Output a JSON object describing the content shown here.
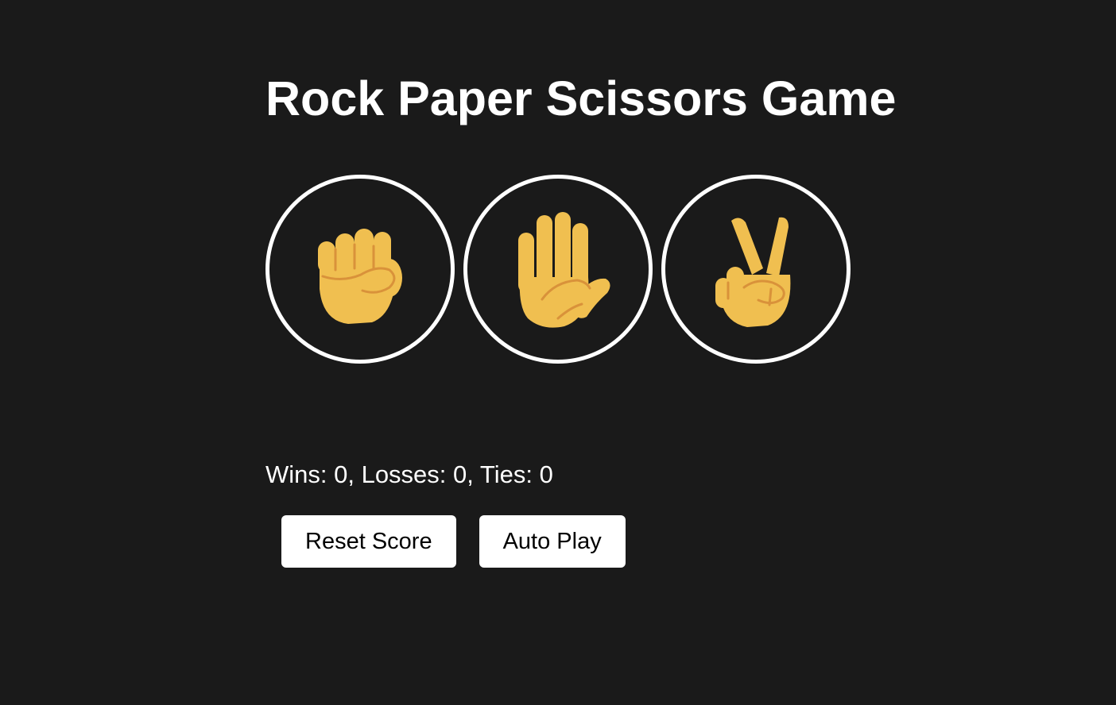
{
  "title": "Rock Paper Scissors Game",
  "moves": [
    {
      "id": "rock",
      "icon": "raised-fist-icon"
    },
    {
      "id": "paper",
      "icon": "raised-hand-icon"
    },
    {
      "id": "scissors",
      "icon": "victory-hand-icon"
    }
  ],
  "score": {
    "text": "Wins: 0, Losses: 0, Ties: 0",
    "wins": 0,
    "losses": 0,
    "ties": 0
  },
  "actions": {
    "reset_label": "Reset Score",
    "autoplay_label": "Auto Play"
  },
  "colors": {
    "background": "#1a1a1a",
    "text": "#ffffff",
    "ring": "#ffffff",
    "skin": "#f0bf50",
    "skin_crease": "#d9923a",
    "button_bg": "#ffffff",
    "button_text": "#000000"
  }
}
